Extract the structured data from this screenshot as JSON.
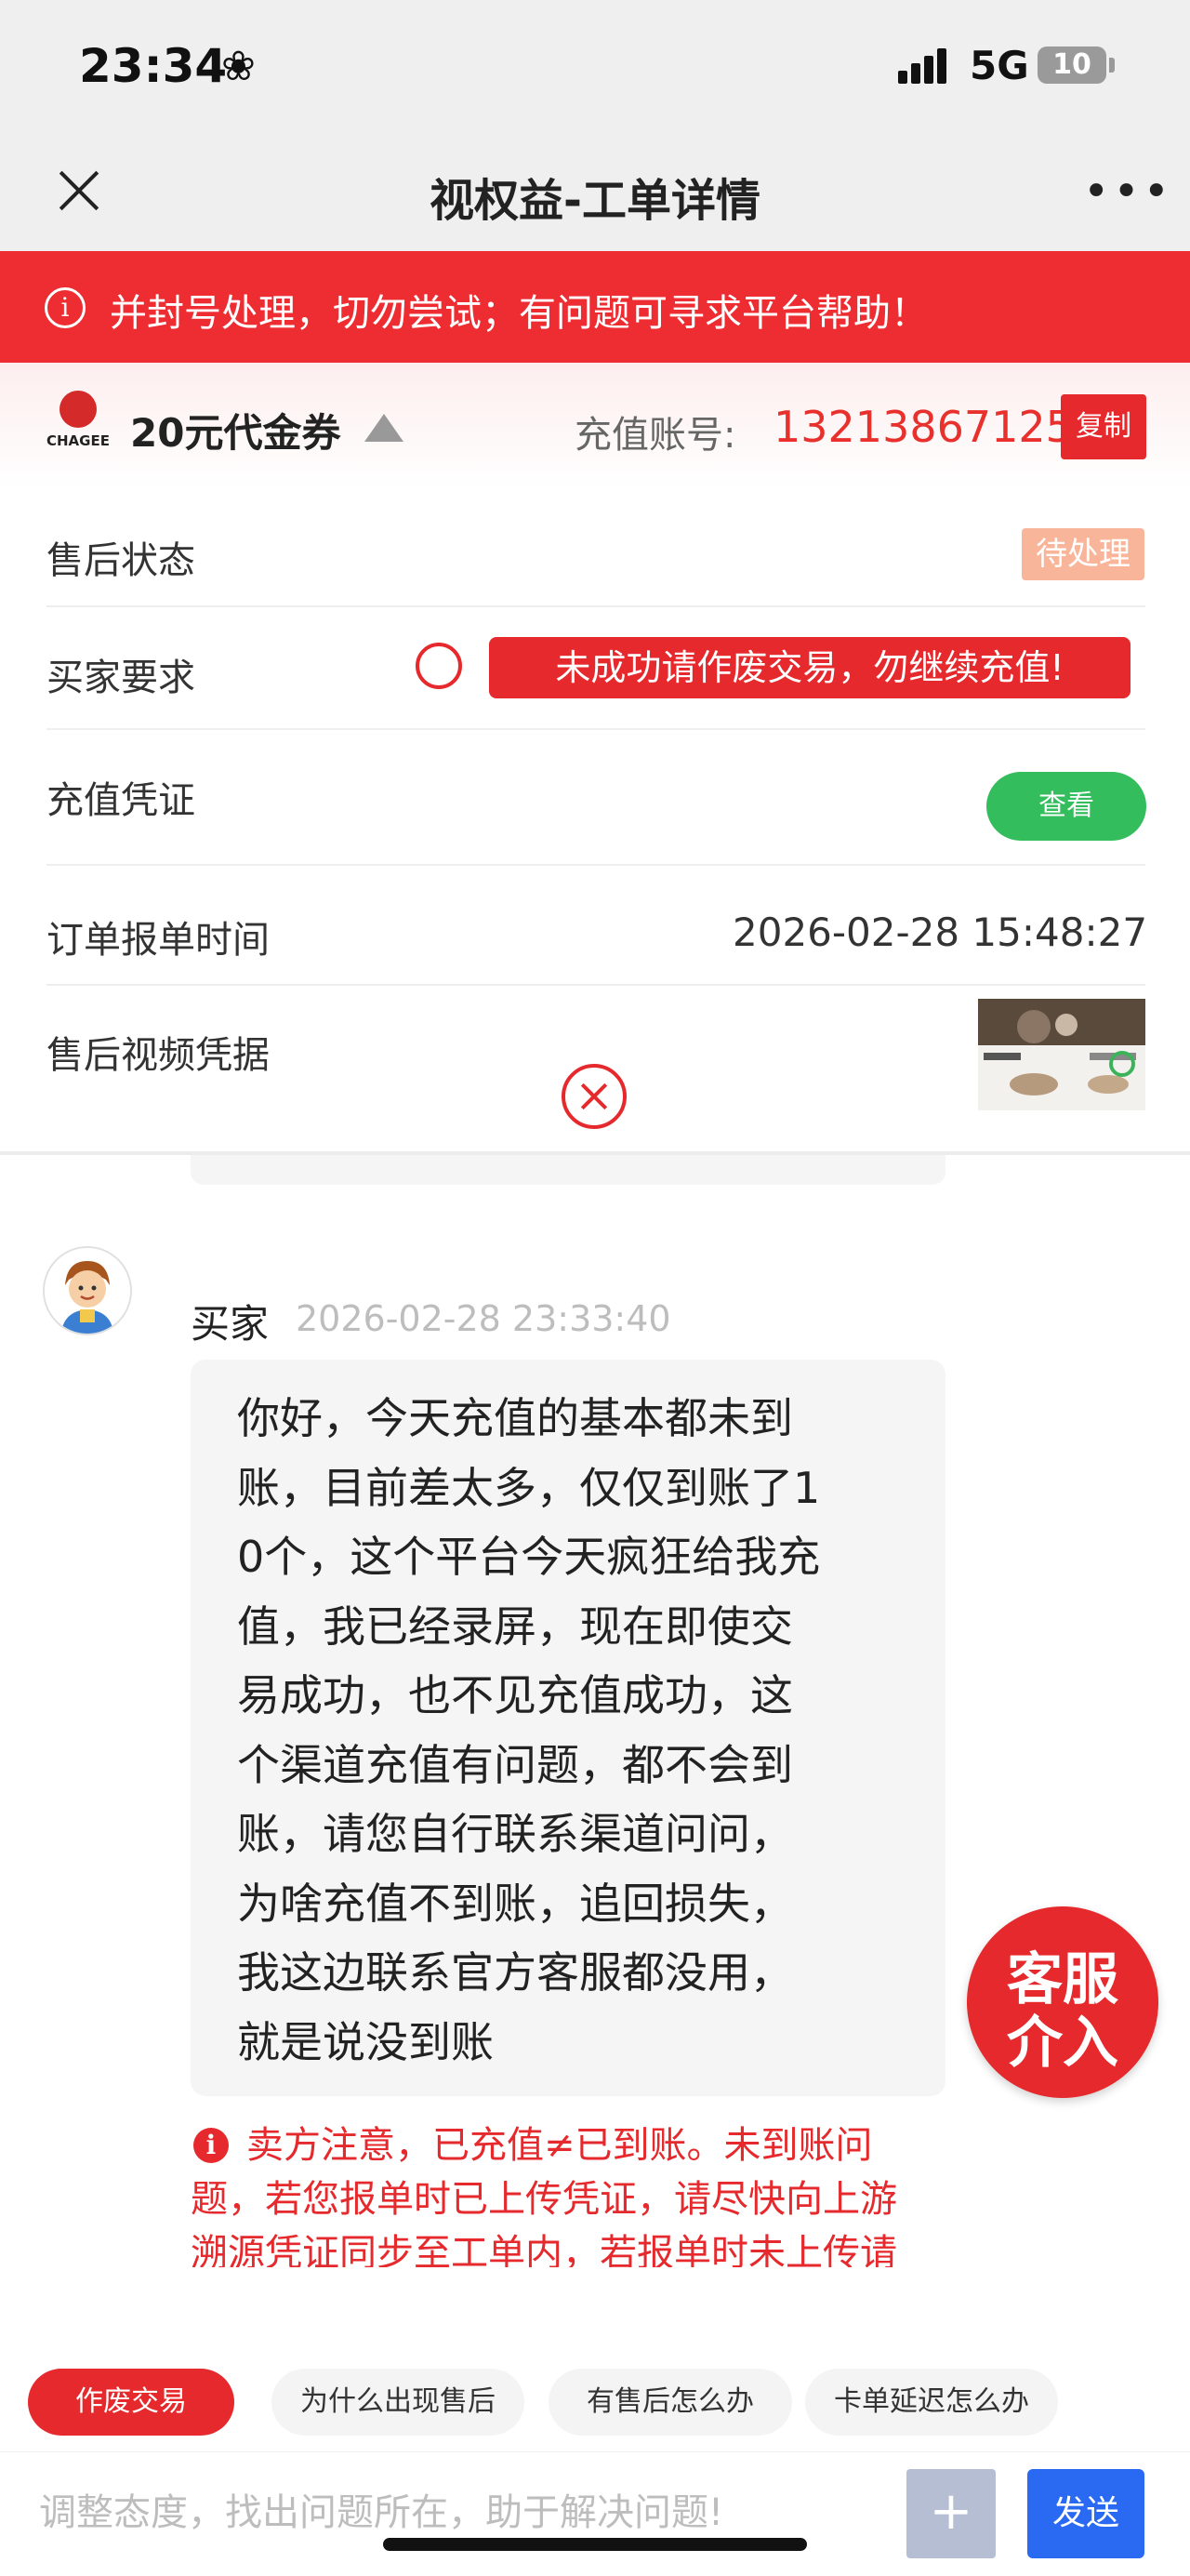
{
  "status_bar": {
    "time": "23:34",
    "network": "5G",
    "battery": "10"
  },
  "nav": {
    "title": "视权益-工单详情"
  },
  "notice": {
    "text": "并封号处理，切勿尝试；有问题可寻求平台帮助！"
  },
  "product": {
    "logo_text": "CHAGEE",
    "name": "20元代金券",
    "account_label": "充值账号:",
    "account_value": "13213867125",
    "copy_label": "复制"
  },
  "details": {
    "after_sale_status_label": "售后状态",
    "after_sale_status_value": "待处理",
    "buyer_request_label": "买家要求",
    "buyer_request_value": "未成功请作废交易，勿继续充值!",
    "voucher_label": "充值凭证",
    "voucher_button": "查看",
    "order_time_label": "订单报单时间",
    "order_time_value": "2026-02-28 15:48:27",
    "video_label": "售后视频凭据"
  },
  "message": {
    "sender": "买家",
    "time": "2026-02-28 23:33:40",
    "lines": [
      "你好，今天充值的基本都未到",
      "账，目前差太多，仅仅到账了1",
      "0个，这个平台今天疯狂给我充",
      "值，我已经录屏，现在即使交",
      "易成功，也不见充值成功，这",
      "个渠道充值有问题，都不会到",
      "账，请您自行联系渠道问问，",
      "为啥充值不到账，追回损失，",
      "我这边联系官方客服都没用，",
      "就是说没到账"
    ]
  },
  "warning": {
    "lines": [
      "卖方注意，已充值≠已到账。未到账问",
      "题，若您报单时已上传凭证，请尽快向上游",
      "溯源凭证同步至工单内，若报单时未上传请"
    ]
  },
  "cs_button": {
    "line1": "客服",
    "line2": "介入"
  },
  "quick_actions": [
    "作废交易",
    "为什么出现售后",
    "有售后怎么办",
    "卡单延迟怎么办"
  ],
  "input": {
    "placeholder": "调整态度，找出问题所在，助于解决问题!",
    "plus": "+",
    "send": "发送"
  },
  "colors": {
    "primary_red": "#e5292c",
    "green": "#33bd5c",
    "blue": "#2a6af2",
    "pending_orange": "#f9b59a"
  },
  "icons": {
    "close": "close-icon",
    "more": "more-icon",
    "info": "info-icon",
    "avatar": "cartoon-avatar"
  }
}
